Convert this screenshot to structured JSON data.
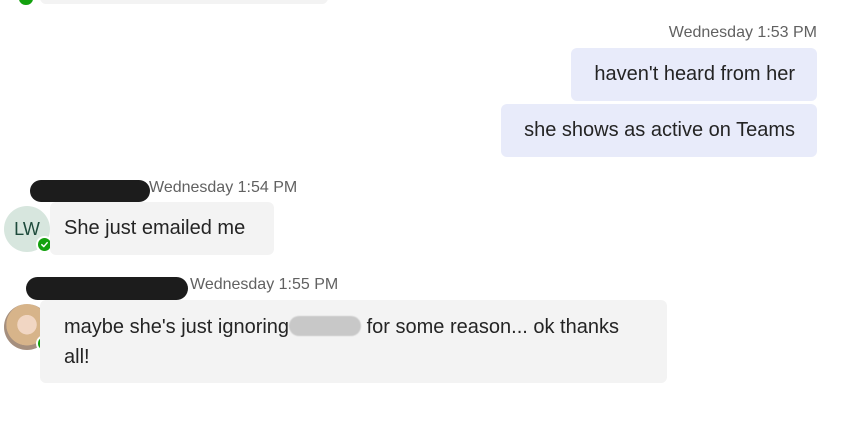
{
  "messages_outgoing": [
    {
      "timestamp": "Wednesday 1:53 PM",
      "text": "haven't heard from her"
    },
    {
      "timestamp": "",
      "text": "she shows as active on Teams"
    }
  ],
  "messages_incoming": [
    {
      "timestamp": "Wednesday 1:54 PM",
      "avatar_initials": "LW",
      "presence": "available",
      "text": "She just emailed me"
    },
    {
      "timestamp": "Wednesday 1:55 PM",
      "avatar_type": "photo",
      "presence": "available",
      "text_before": "maybe she's just ignoring",
      "text_after": " for some reason... ok thanks all!"
    }
  ],
  "colors": {
    "outgoing_bubble": "#e8ebfa",
    "incoming_bubble": "#f3f3f3",
    "presence_available": "#13a10e",
    "timestamp": "#616161",
    "text": "#242424"
  }
}
